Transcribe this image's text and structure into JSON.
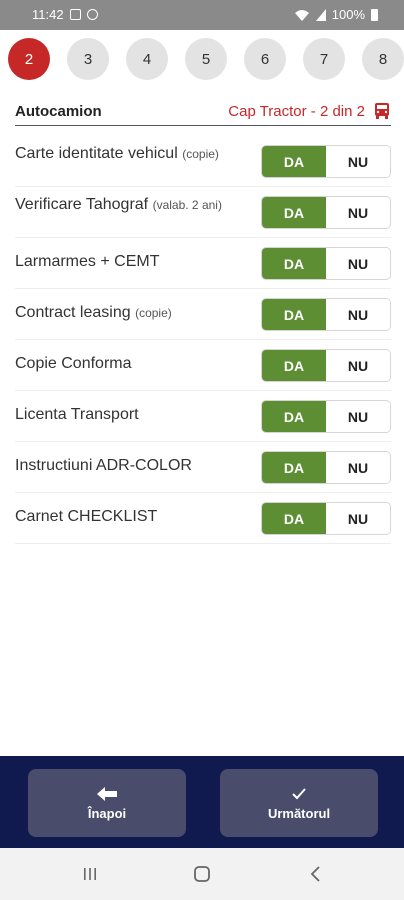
{
  "status_bar": {
    "time": "11:42",
    "battery": "100%"
  },
  "steps": [
    "2",
    "3",
    "4",
    "5",
    "6",
    "7",
    "8"
  ],
  "active_step": "2",
  "section": {
    "title": "Autocamion",
    "subtitle": "Cap Tractor - 2 din 2"
  },
  "rows": [
    {
      "label": "Carte identitate vehicul",
      "note": "(copie)",
      "yes": "DA",
      "no": "NU",
      "selected": "DA"
    },
    {
      "label": "Verificare Tahograf",
      "note": "(valab. 2 ani)",
      "yes": "DA",
      "no": "NU",
      "selected": "DA"
    },
    {
      "label": "Larmarmes + CEMT",
      "note": "",
      "yes": "DA",
      "no": "NU",
      "selected": "DA"
    },
    {
      "label": "Contract leasing",
      "note": "(copie)",
      "yes": "DA",
      "no": "NU",
      "selected": "DA"
    },
    {
      "label": "Copie Conforma",
      "note": "",
      "yes": "DA",
      "no": "NU",
      "selected": "DA"
    },
    {
      "label": "Licenta Transport",
      "note": "",
      "yes": "DA",
      "no": "NU",
      "selected": "DA"
    },
    {
      "label": "Instructiuni ADR-COLOR",
      "note": "",
      "yes": "DA",
      "no": "NU",
      "selected": "DA"
    },
    {
      "label": "Carnet CHECKLIST",
      "note": "",
      "yes": "DA",
      "no": "NU",
      "selected": "DA"
    }
  ],
  "nav": {
    "back_label": "Înapoi",
    "next_label": "Următorul"
  },
  "colors": {
    "accent_red": "#c62828",
    "yes_green": "#5e8e33",
    "nav_bg": "#111a4e",
    "nav_button": "#4a4c6c"
  },
  "icons": {
    "section": "truck-icon",
    "back": "arrow-left-icon",
    "next": "checkmark-icon"
  }
}
